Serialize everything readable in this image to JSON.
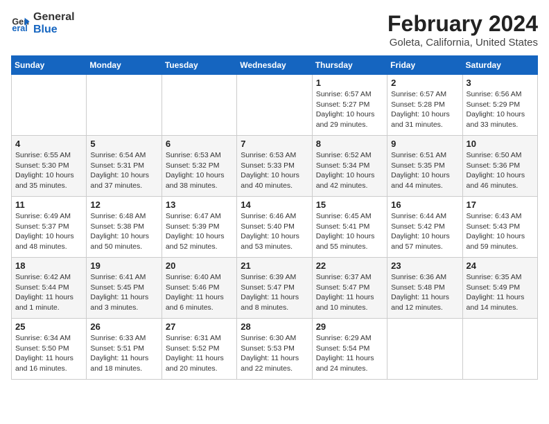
{
  "logo": {
    "line1": "General",
    "line2": "Blue"
  },
  "title": "February 2024",
  "subtitle": "Goleta, California, United States",
  "days_of_week": [
    "Sunday",
    "Monday",
    "Tuesday",
    "Wednesday",
    "Thursday",
    "Friday",
    "Saturday"
  ],
  "weeks": [
    [
      {
        "day": "",
        "info": ""
      },
      {
        "day": "",
        "info": ""
      },
      {
        "day": "",
        "info": ""
      },
      {
        "day": "",
        "info": ""
      },
      {
        "day": "1",
        "info": "Sunrise: 6:57 AM\nSunset: 5:27 PM\nDaylight: 10 hours\nand 29 minutes."
      },
      {
        "day": "2",
        "info": "Sunrise: 6:57 AM\nSunset: 5:28 PM\nDaylight: 10 hours\nand 31 minutes."
      },
      {
        "day": "3",
        "info": "Sunrise: 6:56 AM\nSunset: 5:29 PM\nDaylight: 10 hours\nand 33 minutes."
      }
    ],
    [
      {
        "day": "4",
        "info": "Sunrise: 6:55 AM\nSunset: 5:30 PM\nDaylight: 10 hours\nand 35 minutes."
      },
      {
        "day": "5",
        "info": "Sunrise: 6:54 AM\nSunset: 5:31 PM\nDaylight: 10 hours\nand 37 minutes."
      },
      {
        "day": "6",
        "info": "Sunrise: 6:53 AM\nSunset: 5:32 PM\nDaylight: 10 hours\nand 38 minutes."
      },
      {
        "day": "7",
        "info": "Sunrise: 6:53 AM\nSunset: 5:33 PM\nDaylight: 10 hours\nand 40 minutes."
      },
      {
        "day": "8",
        "info": "Sunrise: 6:52 AM\nSunset: 5:34 PM\nDaylight: 10 hours\nand 42 minutes."
      },
      {
        "day": "9",
        "info": "Sunrise: 6:51 AM\nSunset: 5:35 PM\nDaylight: 10 hours\nand 44 minutes."
      },
      {
        "day": "10",
        "info": "Sunrise: 6:50 AM\nSunset: 5:36 PM\nDaylight: 10 hours\nand 46 minutes."
      }
    ],
    [
      {
        "day": "11",
        "info": "Sunrise: 6:49 AM\nSunset: 5:37 PM\nDaylight: 10 hours\nand 48 minutes."
      },
      {
        "day": "12",
        "info": "Sunrise: 6:48 AM\nSunset: 5:38 PM\nDaylight: 10 hours\nand 50 minutes."
      },
      {
        "day": "13",
        "info": "Sunrise: 6:47 AM\nSunset: 5:39 PM\nDaylight: 10 hours\nand 52 minutes."
      },
      {
        "day": "14",
        "info": "Sunrise: 6:46 AM\nSunset: 5:40 PM\nDaylight: 10 hours\nand 53 minutes."
      },
      {
        "day": "15",
        "info": "Sunrise: 6:45 AM\nSunset: 5:41 PM\nDaylight: 10 hours\nand 55 minutes."
      },
      {
        "day": "16",
        "info": "Sunrise: 6:44 AM\nSunset: 5:42 PM\nDaylight: 10 hours\nand 57 minutes."
      },
      {
        "day": "17",
        "info": "Sunrise: 6:43 AM\nSunset: 5:43 PM\nDaylight: 10 hours\nand 59 minutes."
      }
    ],
    [
      {
        "day": "18",
        "info": "Sunrise: 6:42 AM\nSunset: 5:44 PM\nDaylight: 11 hours\nand 1 minute."
      },
      {
        "day": "19",
        "info": "Sunrise: 6:41 AM\nSunset: 5:45 PM\nDaylight: 11 hours\nand 3 minutes."
      },
      {
        "day": "20",
        "info": "Sunrise: 6:40 AM\nSunset: 5:46 PM\nDaylight: 11 hours\nand 6 minutes."
      },
      {
        "day": "21",
        "info": "Sunrise: 6:39 AM\nSunset: 5:47 PM\nDaylight: 11 hours\nand 8 minutes."
      },
      {
        "day": "22",
        "info": "Sunrise: 6:37 AM\nSunset: 5:47 PM\nDaylight: 11 hours\nand 10 minutes."
      },
      {
        "day": "23",
        "info": "Sunrise: 6:36 AM\nSunset: 5:48 PM\nDaylight: 11 hours\nand 12 minutes."
      },
      {
        "day": "24",
        "info": "Sunrise: 6:35 AM\nSunset: 5:49 PM\nDaylight: 11 hours\nand 14 minutes."
      }
    ],
    [
      {
        "day": "25",
        "info": "Sunrise: 6:34 AM\nSunset: 5:50 PM\nDaylight: 11 hours\nand 16 minutes."
      },
      {
        "day": "26",
        "info": "Sunrise: 6:33 AM\nSunset: 5:51 PM\nDaylight: 11 hours\nand 18 minutes."
      },
      {
        "day": "27",
        "info": "Sunrise: 6:31 AM\nSunset: 5:52 PM\nDaylight: 11 hours\nand 20 minutes."
      },
      {
        "day": "28",
        "info": "Sunrise: 6:30 AM\nSunset: 5:53 PM\nDaylight: 11 hours\nand 22 minutes."
      },
      {
        "day": "29",
        "info": "Sunrise: 6:29 AM\nSunset: 5:54 PM\nDaylight: 11 hours\nand 24 minutes."
      },
      {
        "day": "",
        "info": ""
      },
      {
        "day": "",
        "info": ""
      }
    ]
  ]
}
